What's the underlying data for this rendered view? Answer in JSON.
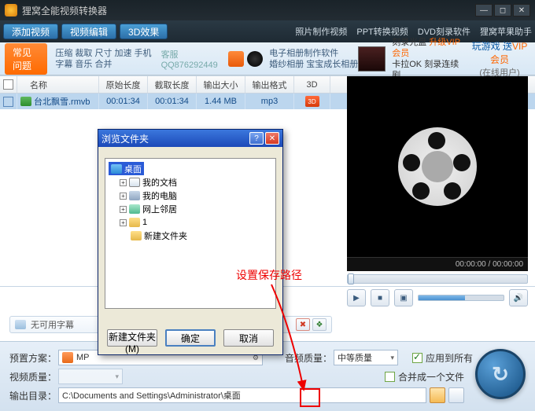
{
  "window": {
    "title": "狸窝全能视频转换器"
  },
  "toolbar": {
    "add_video": "添加视频",
    "video_edit": "视频编辑",
    "effect_3d": "3D效果",
    "links": [
      "照片制作视频",
      "PPT转换视频",
      "DVD刻录软件",
      "狸窝苹果助手"
    ]
  },
  "promo": {
    "faq_tab": "常见问题",
    "kefu": "客服QQ876292449",
    "faq_line1": "压缩 裁取 尺寸 加速 手机",
    "faq_line2": "字幕 音乐 合并",
    "mid1": "电子相册制作软件",
    "mid2": "婚纱相册 宝宝成长相册",
    "mid3a": "刻录光盘 ",
    "mid3b": "升级VIP会员",
    "mid4": "卡拉OK 刻录连续剧",
    "right1a": "玩游戏 送",
    "right1b": "VIP会员",
    "right2": "(在线用户)"
  },
  "table": {
    "headers": {
      "name": "名称",
      "orig": "原始长度",
      "cut": "截取长度",
      "size": "输出大小",
      "fmt": "输出格式",
      "threeD": "3D"
    },
    "rows": [
      {
        "name": "台北飘雪.rmvb",
        "orig": "00:01:34",
        "cut": "00:01:34",
        "size": "1.44 MB",
        "fmt": "mp3",
        "badge": "3D"
      }
    ]
  },
  "subtitle": {
    "none": "无可用字幕"
  },
  "preview": {
    "time": "00:00:00 / 00:00:00"
  },
  "bottom": {
    "preset_label": "预置方案：",
    "preset_value": "MP",
    "audio_q_label": "音频质量：",
    "audio_q_value": "中等质量",
    "video_q_label": "视频质量：",
    "apply_all": "应用到所有",
    "merge": "合并成一个文件",
    "out_dir_label": "输出目录：",
    "out_dir_value": "C:\\Documents and Settings\\Administrator\\桌面"
  },
  "dialog": {
    "title": "浏览文件夹",
    "nodes": {
      "desktop": "桌面",
      "docs": "我的文档",
      "pc": "我的电脑",
      "net": "网上邻居",
      "one": "1",
      "newf": "新建文件夹"
    },
    "new_folder": "新建文件夹(M)",
    "ok": "确定",
    "cancel": "取消"
  },
  "annotation": "设置保存路径"
}
